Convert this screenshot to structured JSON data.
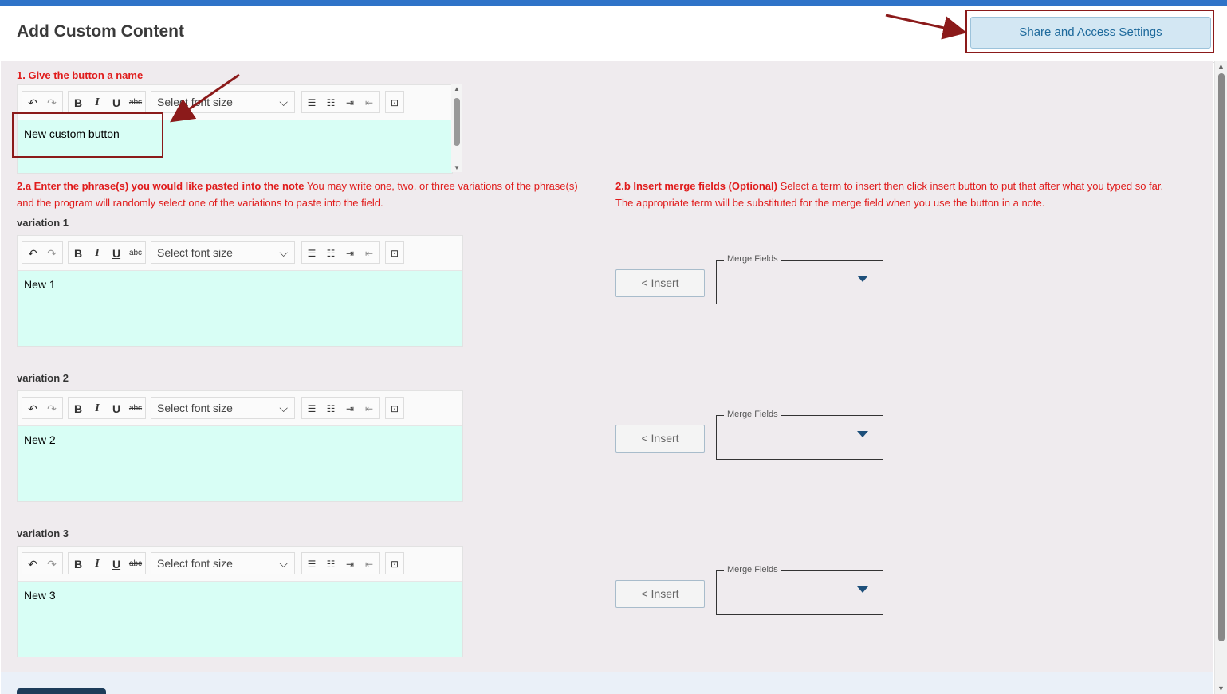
{
  "header": {
    "title": "Add Custom Content",
    "share_button": "Share and Access Settings"
  },
  "section1": {
    "label": "1. Give the button a name",
    "content": "New custom button"
  },
  "section2a": {
    "heading": "2.a Enter the phrase(s) you would like pasted into the note",
    "text_line1": " You may write one, two, or three variations of the phrase(s)",
    "text_line2": "and the program will randomly select one of the variations to paste into the field."
  },
  "section2b": {
    "heading": "2.b Insert merge fields (Optional)",
    "text_line1": " Select a term to insert then click insert button to put that after what you typed so far.",
    "text_line2": "The appropriate term will be substituted for the merge field when you use the button in a note."
  },
  "toolbar": {
    "font_size_placeholder": "Select font size",
    "bold": "B",
    "italic": "I",
    "underline": "U",
    "strike": "abc",
    "undo_icon": "undo-icon",
    "redo_icon": "redo-icon"
  },
  "variations": [
    {
      "label": "variation 1",
      "content": "New 1"
    },
    {
      "label": "variation 2",
      "content": "New 2"
    },
    {
      "label": "variation 3",
      "content": "New 3"
    }
  ],
  "insert_button": "< Insert",
  "merge_fields_label": "Merge Fields",
  "colors": {
    "accent": "#2f73c8",
    "label_red": "#e01b1b",
    "editor_bg": "#d8fef5",
    "annotation": "#8b1a1a"
  }
}
